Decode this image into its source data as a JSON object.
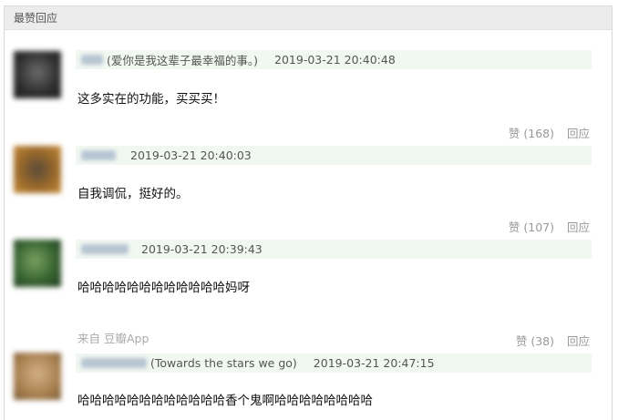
{
  "section_title": "最赞回应",
  "comments": [
    {
      "avatar_color": "#3a3a3a",
      "signature": "(爱你是我这辈子最幸福的事。)",
      "timestamp": "2019-03-21 20:40:48",
      "content": "这多实在的功能，买买买！",
      "vote_label": "赞 (168)",
      "reply_label": "回应"
    },
    {
      "avatar_color": "#8a5a2a",
      "signature": "",
      "timestamp": "2019-03-21 20:40:03",
      "content": "自我调侃，挺好的。",
      "vote_label": "赞 (107)",
      "reply_label": "回应"
    },
    {
      "avatar_color": "#3f6a3a",
      "signature": "",
      "timestamp": "2019-03-21 20:39:43",
      "content": "哈哈哈哈哈哈哈哈哈哈哈哈妈呀",
      "source_label": "来自 豆瓣App",
      "vote_label": "赞 (38)",
      "reply_label": "回应"
    },
    {
      "avatar_color": "#b08a5a",
      "signature": "(Towards the stars we go)",
      "timestamp": "2019-03-21 20:47:15",
      "content": "哈哈哈哈哈哈哈哈哈哈哈哈香个鬼啊哈哈哈哈哈哈哈哈"
    }
  ]
}
